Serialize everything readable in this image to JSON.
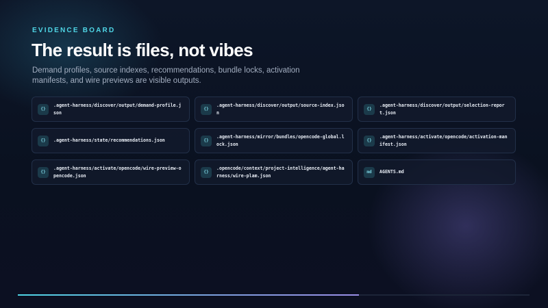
{
  "eyebrow": "EVIDENCE BOARD",
  "title": "The result is files, not vibes",
  "subtitle": "Demand profiles, source indexes, recommendations, bundle locks, activation manifests, and wire previews are visible outputs.",
  "files": [
    {
      "badge": "{}",
      "icon": "json-file-icon",
      "path": ".agent-harness/discover/output/demand-profile.json"
    },
    {
      "badge": "{}",
      "icon": "json-file-icon",
      "path": ".agent-harness/discover/output/source-index.json"
    },
    {
      "badge": "{}",
      "icon": "json-file-icon",
      "path": ".agent-harness/discover/output/selection-report.json"
    },
    {
      "badge": "{}",
      "icon": "json-file-icon",
      "path": ".agent-harness/state/recommendations.json"
    },
    {
      "badge": "{}",
      "icon": "json-file-icon",
      "path": ".agent-harness/mirror/bundles/opencode-global.lock.json"
    },
    {
      "badge": "{}",
      "icon": "json-file-icon",
      "path": ".agent-harness/activate/opencode/activation-manifest.json"
    },
    {
      "badge": "{}",
      "icon": "json-file-icon",
      "path": ".agent-harness/activate/opencode/wire-preview-opencode.json"
    },
    {
      "badge": "{}",
      "icon": "json-file-icon",
      "path": ".opencode/context/project-intelligence/agent-harness/wire-plam.json"
    },
    {
      "badge": "md",
      "icon": "markdown-file-icon",
      "path": "AGENTS.md"
    }
  ],
  "progress": {
    "fraction": 0.667
  },
  "colors": {
    "accent": "#4fd6e6",
    "background": "#0b1221",
    "card": "#121a2c",
    "badge": "#1b3a4a"
  }
}
